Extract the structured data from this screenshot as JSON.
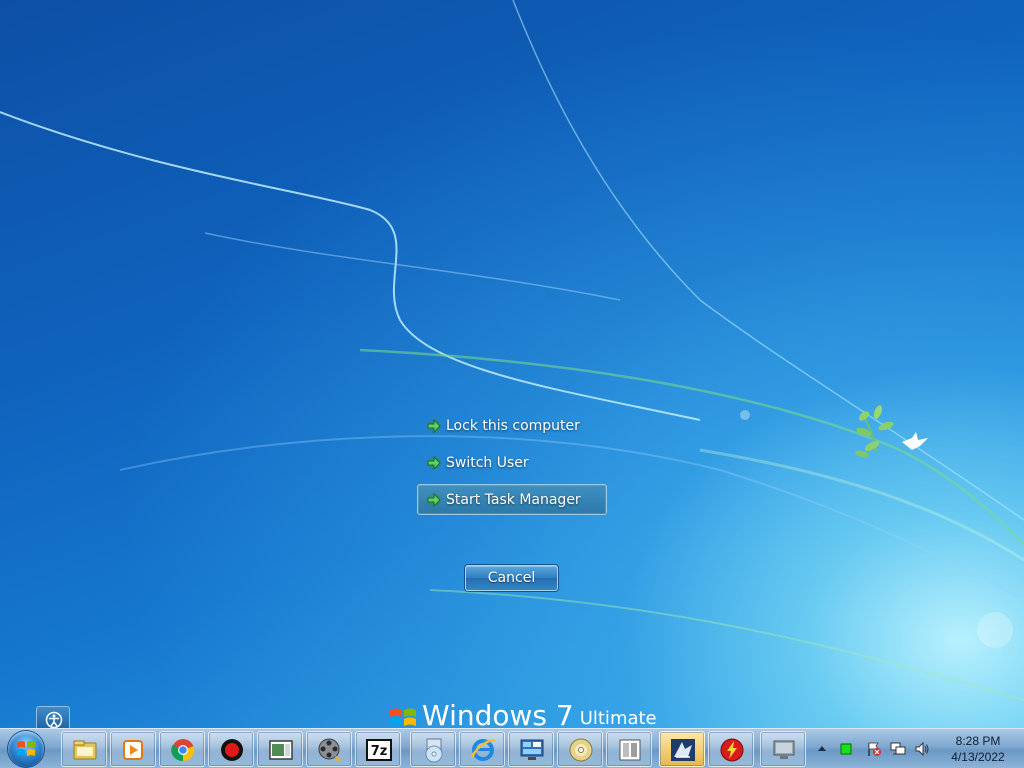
{
  "security_screen": {
    "options": [
      {
        "label": "Lock this computer",
        "selected": false
      },
      {
        "label": "Switch User",
        "selected": false
      },
      {
        "label": "Start Task Manager",
        "selected": true
      }
    ],
    "cancel_label": "Cancel",
    "ease_of_access_icon": "ease-of-access-icon"
  },
  "branding": {
    "name": "Windows 7",
    "edition": "Ultimate",
    "logo_icon": "windows-flag-icon"
  },
  "taskbar": {
    "start_icon": "windows-start-orb-icon",
    "pinned": [
      {
        "name": "file-explorer-icon"
      },
      {
        "name": "media-player-icon"
      },
      {
        "name": "chrome-icon"
      },
      {
        "name": "screen-recorder-icon"
      },
      {
        "name": "window-app-icon"
      },
      {
        "name": "movie-maker-icon"
      },
      {
        "name": "7zip-icon",
        "text": "7z"
      },
      {
        "name": "disc-burner-icon"
      },
      {
        "name": "internet-explorer-icon"
      },
      {
        "name": "control-panel-icon"
      },
      {
        "name": "cd-drive-icon"
      },
      {
        "name": "book-reader-icon"
      },
      {
        "name": "snipping-tool-icon",
        "active": true
      },
      {
        "name": "flash-app-icon"
      },
      {
        "name": "remote-desktop-icon"
      }
    ],
    "tray": {
      "icons": [
        "show-hidden-icons-icon",
        "green-status-icon",
        "action-center-icon",
        "network-icon",
        "volume-icon"
      ],
      "time": "8:28 PM",
      "date": "4/13/2022"
    }
  },
  "colors": {
    "selected_option_bg": "#3384b6",
    "taskbar": "#7fa8cf"
  }
}
